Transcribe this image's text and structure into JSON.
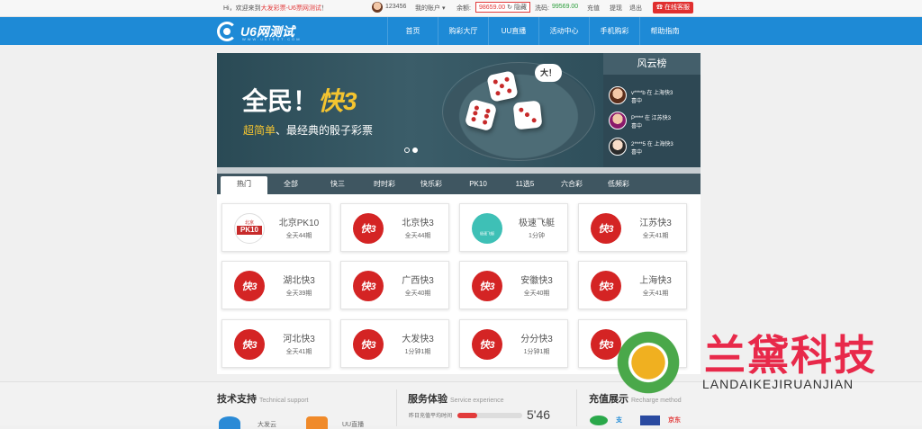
{
  "topbar": {
    "welcome_prefix": "Hi，欢迎来到",
    "welcome_site": "大发彩票-U6票网测试",
    "welcome_suffix": "！",
    "user_id": "123456",
    "my_account": "我的账户 ▾",
    "balance_label": "余额:",
    "balance_value": "98659.00",
    "hide_label": "↻ 隐藏",
    "points_label": "洗码:",
    "points_value": "99569.00",
    "recharge": "充值",
    "withdraw": "提现",
    "logout": "退出",
    "online_service": "在线客服"
  },
  "nav": {
    "logo_text": "U6网测试",
    "logo_sub": "WWW.U6TEST.COM",
    "items": [
      "首页",
      "购彩大厅",
      "UU直播",
      "活动中心",
      "手机购彩",
      "帮助指南"
    ]
  },
  "banner": {
    "title_main": "全民！",
    "title_accent": "快3",
    "subtitle_hl": "超简单",
    "subtitle_rest": "、最经典的骰子彩票",
    "bubble": "大！"
  },
  "rank": {
    "title": "风云榜",
    "entries": [
      {
        "user": "v****b",
        "where": "在 上海快3",
        "status": "喜中",
        "amount": ""
      },
      {
        "user": "P****",
        "where": "在 江苏快3",
        "status": "喜中",
        "amount": ""
      },
      {
        "user": "2****5",
        "where": "在 上海快3",
        "status": "喜中",
        "amount": ""
      }
    ]
  },
  "tabs": [
    "热门",
    "全部",
    "快三",
    "时时彩",
    "快乐彩",
    "PK10",
    "11选5",
    "六合彩",
    "低频彩"
  ],
  "games": [
    {
      "name": "北京PK10",
      "period": "全天44期",
      "icon": "pk10-icon"
    },
    {
      "name": "北京快3",
      "period": "全天44期",
      "icon": "k3-icon"
    },
    {
      "name": "极速飞艇",
      "period": "1分钟",
      "icon": "boat-icon"
    },
    {
      "name": "江苏快3",
      "period": "全天41期",
      "icon": "k3-icon"
    },
    {
      "name": "湖北快3",
      "period": "全天39期",
      "icon": "k3-icon"
    },
    {
      "name": "广西快3",
      "period": "全天40期",
      "icon": "k3-icon"
    },
    {
      "name": "安徽快3",
      "period": "全天40期",
      "icon": "k3-icon"
    },
    {
      "name": "上海快3",
      "period": "全天41期",
      "icon": "k3-icon"
    },
    {
      "name": "河北快3",
      "period": "全天41期",
      "icon": "k3-icon"
    },
    {
      "name": "大发快3",
      "period": "1分钟1期",
      "icon": "k3-icon"
    },
    {
      "name": "分分快3",
      "period": "1分钟1期",
      "icon": "k3-icon"
    },
    {
      "name": "",
      "period": "",
      "icon": "k3-icon"
    }
  ],
  "bottom": {
    "support_title": "技术支持",
    "support_en": "Technical support",
    "support_items": [
      "大发云",
      "UU直播"
    ],
    "service_title": "服务体验",
    "service_en": "Service experience",
    "recharge_label": "昨日充值平均时间",
    "recharge_fill": 0.3,
    "recharge_time": "5'46",
    "recharge_title": "充值展示",
    "recharge_en": "Recharge method",
    "pay_methods": [
      "支",
      "京东"
    ]
  },
  "watermark": {
    "cn": "兰黛科技",
    "en": "LANDAIKEJIRUANJIAN"
  },
  "colors": {
    "nav_blue": "#1e8ad6",
    "accent_red": "#e23b3b",
    "tab_bar": "#3f5661",
    "banner_bg": "#2f4f5b"
  }
}
